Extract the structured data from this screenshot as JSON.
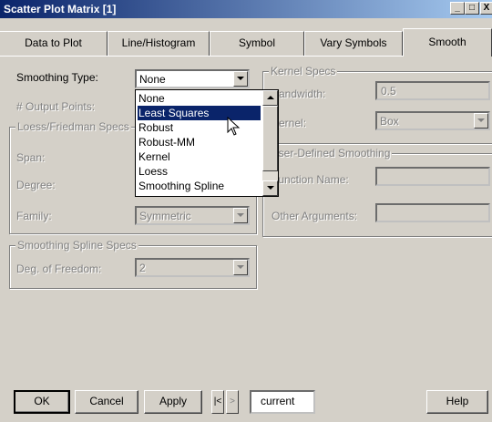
{
  "window": {
    "title": "Scatter Plot Matrix [1]",
    "minimize_glyph": "_",
    "maximize_glyph": "□",
    "close_glyph": "X"
  },
  "tabs": [
    {
      "label": "Data to Plot"
    },
    {
      "label": "Line/Histogram"
    },
    {
      "label": "Symbol"
    },
    {
      "label": "Vary Symbols"
    },
    {
      "label": "Smooth",
      "active": true
    }
  ],
  "smoothing": {
    "type_label": "Smoothing Type:",
    "type_value": "None",
    "output_points_label": "# Output Points:"
  },
  "loess_group": {
    "title": "Loess/Friedman Specs",
    "span_label": "Span:",
    "degree_label": "Degree:",
    "family_label": "Family:",
    "family_value": "Symmetric"
  },
  "spline_group": {
    "title": "Smoothing Spline Specs",
    "dof_label": "Deg. of Freedom:",
    "dof_value": "2"
  },
  "kernel_group": {
    "title": "Kernel Specs",
    "bandwidth_label": "Bandwidth:",
    "bandwidth_value": "0.5",
    "kernel_label": "Kernel:",
    "kernel_value": "Box"
  },
  "user_group": {
    "title": "User-Defined Smoothing",
    "function_label": "Function Name:",
    "other_args_label": "Other Arguments:"
  },
  "dropdown": {
    "options": [
      "None",
      "Least Squares",
      "Robust",
      "Robust-MM",
      "Kernel",
      "Loess",
      "Smoothing Spline"
    ],
    "highlighted": "Least Squares"
  },
  "footer": {
    "ok": "OK",
    "cancel": "Cancel",
    "apply": "Apply",
    "prev": "|<",
    "next": ">",
    "current": "current",
    "help": "Help"
  },
  "colors": {
    "title_start": "#0a246a",
    "title_end": "#a6caf0",
    "selection": "#0a246a",
    "face": "#d4d0c8"
  }
}
